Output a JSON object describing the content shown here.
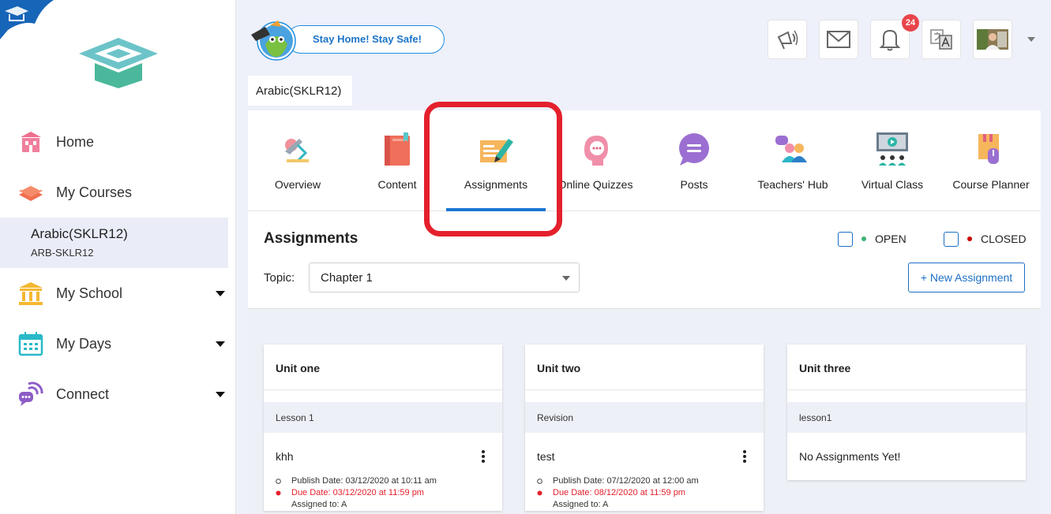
{
  "sidebar": {
    "items": [
      {
        "label": "Home",
        "icon": "home-icon"
      },
      {
        "label": "My Courses",
        "icon": "courses-icon"
      },
      {
        "label": "My School",
        "icon": "school-icon"
      },
      {
        "label": "My Days",
        "icon": "calendar-icon"
      },
      {
        "label": "Connect",
        "icon": "connect-icon"
      }
    ],
    "active_course": {
      "title": "Arabic(SKLR12)",
      "code": "ARB-SKLR12"
    }
  },
  "header": {
    "banner": "Stay Home! Stay Safe!",
    "notification_count": "24",
    "icons": [
      "megaphone-icon",
      "mail-icon",
      "bell-icon",
      "translate-icon",
      "profile-avatar"
    ]
  },
  "course_tab": "Arabic(SKLR12)",
  "tabs": [
    {
      "label": "Overview",
      "icon": "overview-icon"
    },
    {
      "label": "Content",
      "icon": "book-icon"
    },
    {
      "label": "Assignments",
      "icon": "assignment-icon",
      "active": true
    },
    {
      "label": "Online Quizzes",
      "icon": "quiz-icon"
    },
    {
      "label": "Posts",
      "icon": "chat-icon"
    },
    {
      "label": "Teachers' Hub",
      "icon": "teachers-icon"
    },
    {
      "label": "Virtual Class",
      "icon": "virtual-class-icon"
    },
    {
      "label": "Course Planner",
      "icon": "planner-icon"
    }
  ],
  "assignments": {
    "title": "Assignments",
    "filters": [
      {
        "label": "OPEN",
        "color": "#3cb371"
      },
      {
        "label": "CLOSED",
        "color": "#cc0000"
      }
    ],
    "topic_label": "Topic:",
    "topic_value": "Chapter 1",
    "new_button": "+ New Assignment"
  },
  "units": [
    {
      "title": "Unit one",
      "lesson": "Lesson 1",
      "item": {
        "name": "khh",
        "publish": "Publish Date: 03/12/2020 at 10:11 am",
        "due": "Due Date: 03/12/2020 at 11:59 pm",
        "assigned": "Assigned to: A"
      }
    },
    {
      "title": "Unit two",
      "lesson": "Revision",
      "item": {
        "name": "test",
        "publish": "Publish Date: 07/12/2020 at 12:00 am",
        "due": "Due Date: 08/12/2020 at 11:59 pm",
        "assigned": "Assigned to: A"
      }
    },
    {
      "title": "Unit three",
      "lesson": "lesson1",
      "empty": "No Assignments Yet!"
    }
  ],
  "colors": {
    "accent": "#1b76d3",
    "highlight": "#e4202c",
    "due": "#e4202c"
  }
}
